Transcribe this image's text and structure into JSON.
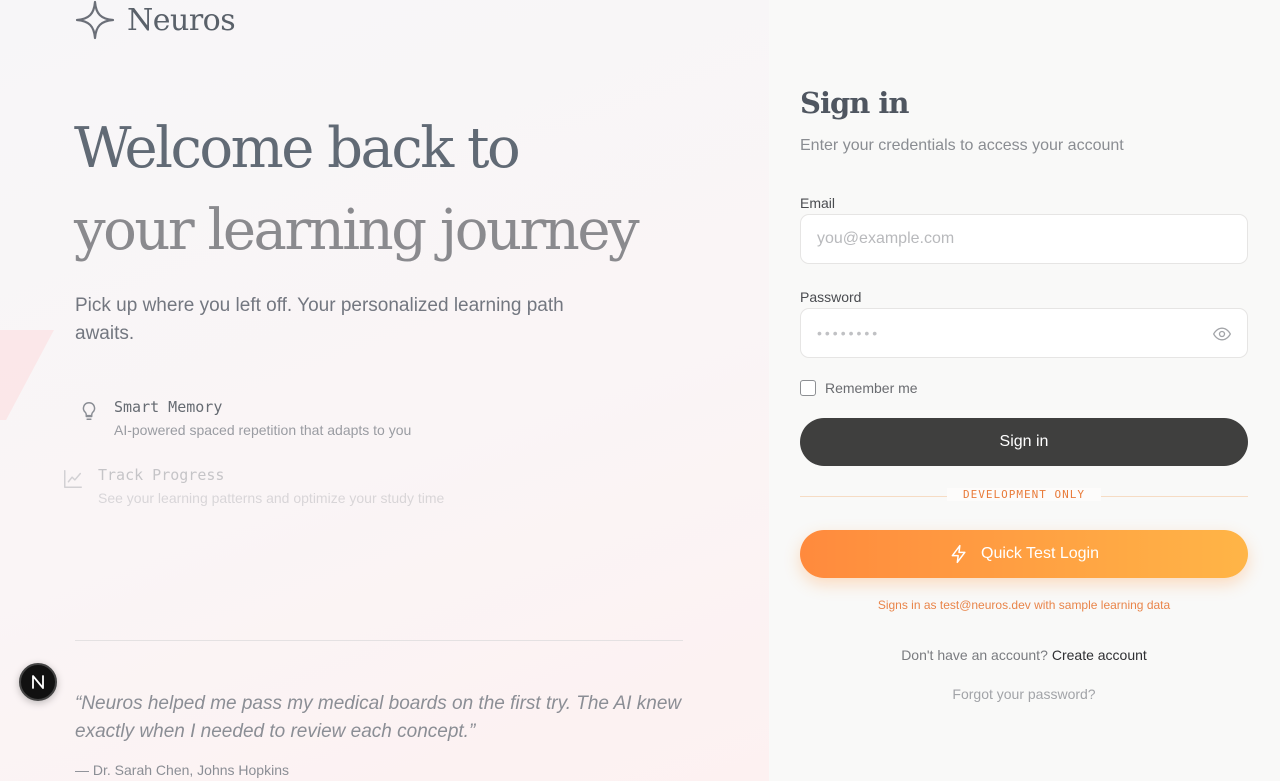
{
  "brand": {
    "name": "Neuros",
    "icon": "sparkle-icon"
  },
  "hero": {
    "line1": "Welcome back to",
    "line2": "your learning journey",
    "subtitle": "Pick up where you left off. Your personalized learning path awaits."
  },
  "features": [
    {
      "icon": "lightbulb-icon",
      "title": "Smart Memory",
      "description": "AI-powered spaced repetition that adapts to you"
    },
    {
      "icon": "trend-chart-icon",
      "title": "Track Progress",
      "description": "See your learning patterns and optimize your study time"
    }
  ],
  "testimonial": {
    "quote": "“Neuros helped me pass my medical boards on the first try. The AI knew exactly when I needed to review each concept.”",
    "author": "— Dr. Sarah Chen, Johns Hopkins"
  },
  "dev_badge": {
    "letter": "N"
  },
  "form": {
    "title": "Sign in",
    "subtitle": "Enter your credentials to access your account",
    "email_label": "Email",
    "email_placeholder": "you@example.com",
    "password_label": "Password",
    "password_mask": "••••••••",
    "remember_label": "Remember me",
    "signin_label": "Sign in",
    "dev_only_label": "DEVELOPMENT ONLY",
    "quick_login_label": "Quick Test Login",
    "quick_login_note": "Signs in as test@neuros.dev with sample learning data",
    "no_account_text": "Don't have an account?",
    "create_account_label": "Create account",
    "forgot_password_label": "Forgot your password?"
  },
  "colors": {
    "accent_orange": "#ff8a3d",
    "accent_orange_end": "#ffb547",
    "dark_button": "#3f3f3e"
  }
}
